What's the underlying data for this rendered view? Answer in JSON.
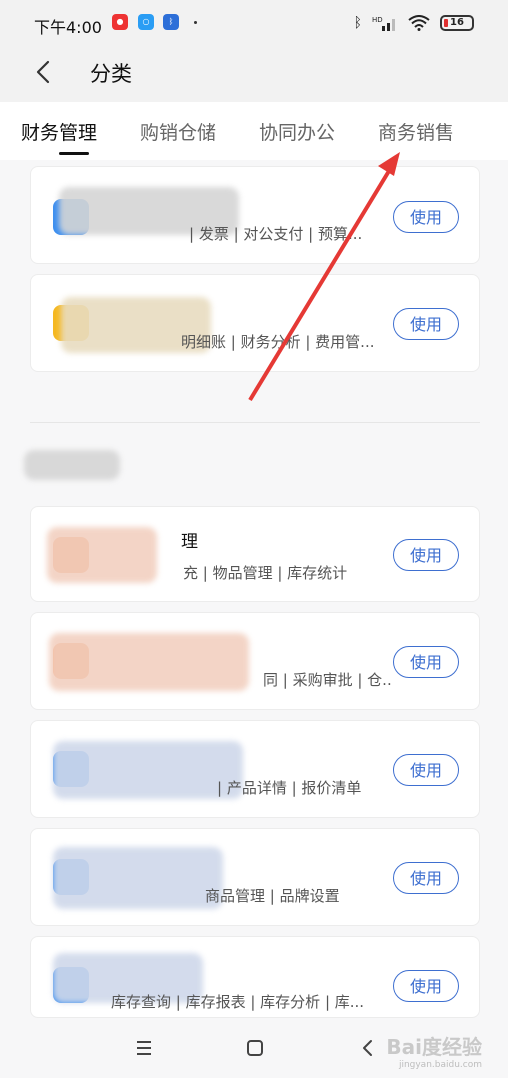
{
  "status_bar": {
    "time": "下午4:00",
    "battery": "16",
    "battery_fraction": 0.16,
    "icons": [
      "red-app-icon",
      "chat-app-icon",
      "bluetooth-app-icon",
      "bluetooth-icon",
      "signal-icon",
      "wifi-icon",
      "battery-icon"
    ]
  },
  "header": {
    "title": "分类"
  },
  "tabs": [
    {
      "label": "财务管理"
    },
    {
      "label": "购销仓储"
    },
    {
      "label": "协同办公"
    },
    {
      "label": "商务销售"
    }
  ],
  "cards": [
    {
      "title": "",
      "desc": "| 发票 | 对公支付 | 预算...",
      "button": "使用",
      "icon_color": "#3b8ef0"
    },
    {
      "title": "",
      "desc": "明细账 | 财务分析 | 费用管...",
      "button": "使用",
      "icon_color": "#f5b820"
    },
    {
      "title": "理",
      "desc": "充 | 物品管理 | 库存统计",
      "button": "使用",
      "icon_color": "#f07a3a"
    },
    {
      "title": "",
      "desc": "同 | 采购审批 | 仓...",
      "button": "使用",
      "icon_color": "#f07a3a"
    },
    {
      "title": "",
      "desc": "| 产品详情 | 报价清单",
      "button": "使用",
      "icon_color": "#3b8ef0"
    },
    {
      "title": "",
      "desc": "商品管理 | 品牌设置",
      "button": "使用",
      "icon_color": "#3b8ef0"
    },
    {
      "title": "",
      "desc": "库存查询 | 库存报表 | 库存分析 | 库...",
      "button": "使用",
      "icon_color": "#3b8ef0"
    }
  ],
  "section_header": "",
  "nav_bar": [
    "menu-icon",
    "home-icon",
    "back-icon"
  ],
  "watermark": {
    "main": "Bai度经验",
    "sub": "jingyan.baidu.com"
  },
  "colors": {
    "accent": "#3e6fd0",
    "arrow": "#e53935"
  }
}
